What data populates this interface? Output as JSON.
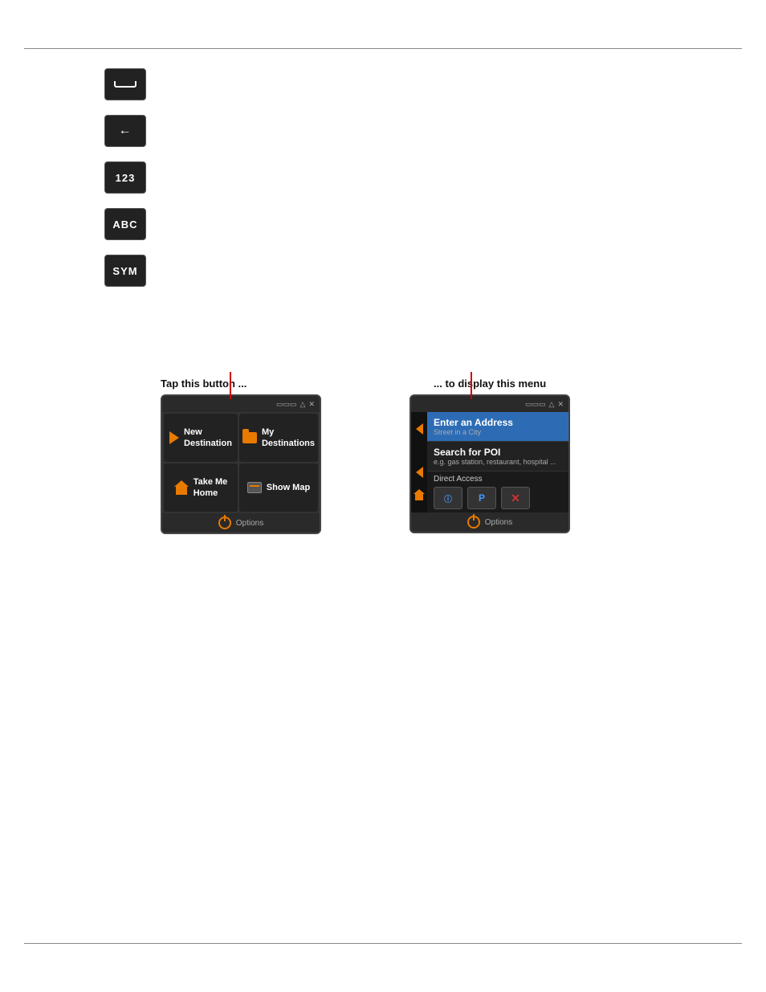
{
  "page": {
    "top_rule": true,
    "bottom_rule": true
  },
  "keyboard_buttons": [
    {
      "id": "space-btn",
      "type": "space",
      "label": "space"
    },
    {
      "id": "backspace-btn",
      "type": "backspace",
      "label": "←"
    },
    {
      "id": "num-btn",
      "type": "text",
      "label": "123"
    },
    {
      "id": "abc-btn",
      "type": "text",
      "label": "ABC"
    },
    {
      "id": "sym-btn",
      "type": "text",
      "label": "SYM"
    }
  ],
  "section_left": {
    "label": "Tap this button ...",
    "device": {
      "status_icons": [
        "battery",
        "signal",
        "x"
      ],
      "buttons": [
        {
          "id": "new-destination",
          "icon": "arrow",
          "line1": "New",
          "line2": "Destination"
        },
        {
          "id": "my-destinations",
          "icon": "folder",
          "line1": "My",
          "line2": "Destinations"
        },
        {
          "id": "take-me-home",
          "icon": "house",
          "line1": "Take Me",
          "line2": "Home"
        },
        {
          "id": "show-map",
          "icon": "map",
          "line1": "Show Map",
          "line2": ""
        }
      ],
      "options_label": "Options"
    }
  },
  "section_right": {
    "label": "... to display this menu",
    "device": {
      "status_icons": [
        "battery",
        "signal",
        "x"
      ],
      "menu_items": [
        {
          "id": "enter-address",
          "title": "Enter an Address",
          "subtitle": "Street in a City",
          "active": true
        },
        {
          "id": "search-poi",
          "title": "Search for POI",
          "subtitle": "e.g. gas station, restaurant, hospital ...",
          "active": false
        }
      ],
      "direct_access_label": "Direct Access",
      "direct_access_icons": [
        "info",
        "P",
        "X"
      ],
      "options_label": "Options"
    }
  }
}
